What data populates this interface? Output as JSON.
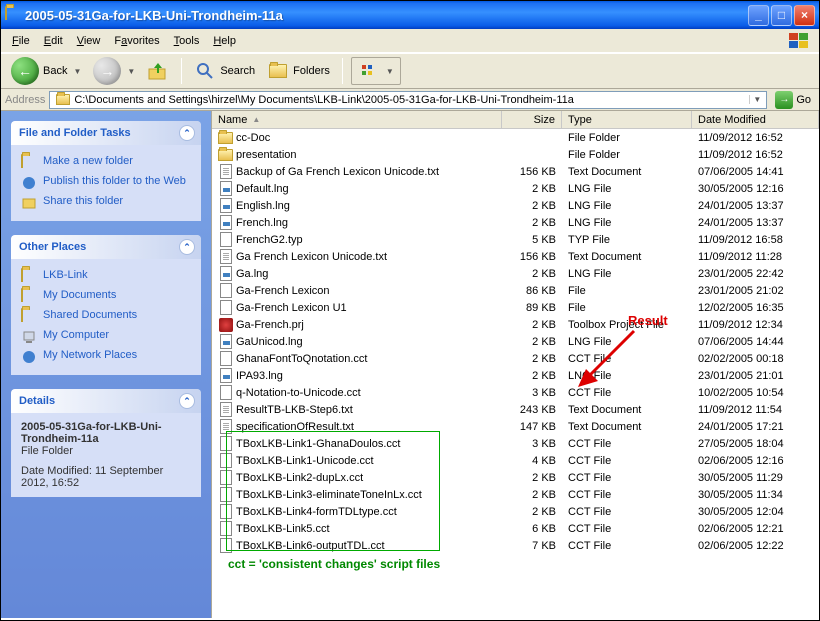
{
  "window": {
    "title": "2005-05-31Ga-for-LKB-Uni-Trondheim-11a"
  },
  "menu": [
    "File",
    "Edit",
    "View",
    "Favorites",
    "Tools",
    "Help"
  ],
  "toolbar": {
    "back": "Back",
    "search": "Search",
    "folders": "Folders"
  },
  "address": {
    "label": "Address",
    "path": "C:\\Documents and Settings\\hirzel\\My Documents\\LKB-Link\\2005-05-31Ga-for-LKB-Uni-Trondheim-11a",
    "go": "Go"
  },
  "sidepanel": {
    "tasks": {
      "title": "File and Folder Tasks",
      "items": [
        "Make a new folder",
        "Publish this folder to the Web",
        "Share this folder"
      ]
    },
    "places": {
      "title": "Other Places",
      "items": [
        "LKB-Link",
        "My Documents",
        "Shared Documents",
        "My Computer",
        "My Network Places"
      ]
    },
    "details": {
      "title": "Details",
      "name": "2005-05-31Ga-for-LKB-Uni-Trondheim-11a",
      "kind": "File Folder",
      "modified": "Date Modified: 11 September 2012, 16:52"
    }
  },
  "columns": {
    "name": "Name",
    "size": "Size",
    "type": "Type",
    "date": "Date Modified"
  },
  "files": [
    {
      "icon": "folder",
      "name": "cc-Doc",
      "size": "",
      "type": "File Folder",
      "date": "11/09/2012 16:52"
    },
    {
      "icon": "folder",
      "name": "presentation",
      "size": "",
      "type": "File Folder",
      "date": "11/09/2012 16:52"
    },
    {
      "icon": "txt",
      "name": "Backup of Ga French Lexicon Unicode.txt",
      "size": "156 KB",
      "type": "Text Document",
      "date": "07/06/2005 14:41"
    },
    {
      "icon": "lng",
      "name": "Default.lng",
      "size": "2 KB",
      "type": "LNG File",
      "date": "30/05/2005 12:16"
    },
    {
      "icon": "lng",
      "name": "English.lng",
      "size": "2 KB",
      "type": "LNG File",
      "date": "24/01/2005 13:37"
    },
    {
      "icon": "lng",
      "name": "French.lng",
      "size": "2 KB",
      "type": "LNG File",
      "date": "24/01/2005 13:37"
    },
    {
      "icon": "typ",
      "name": "FrenchG2.typ",
      "size": "5 KB",
      "type": "TYP File",
      "date": "11/09/2012 16:58"
    },
    {
      "icon": "txt",
      "name": "Ga French Lexicon Unicode.txt",
      "size": "156 KB",
      "type": "Text Document",
      "date": "11/09/2012 11:28"
    },
    {
      "icon": "lng",
      "name": "Ga.lng",
      "size": "2 KB",
      "type": "LNG File",
      "date": "23/01/2005 22:42"
    },
    {
      "icon": "file",
      "name": "Ga-French Lexicon",
      "size": "86 KB",
      "type": "File",
      "date": "23/01/2005 21:02"
    },
    {
      "icon": "file",
      "name": "Ga-French Lexicon U1",
      "size": "89 KB",
      "type": "File",
      "date": "12/02/2005 16:35"
    },
    {
      "icon": "prj",
      "name": "Ga-French.prj",
      "size": "2 KB",
      "type": "Toolbox Project File",
      "date": "11/09/2012 12:34"
    },
    {
      "icon": "lng",
      "name": "GaUnicod.lng",
      "size": "2 KB",
      "type": "LNG File",
      "date": "07/06/2005 14:44"
    },
    {
      "icon": "cct",
      "name": "GhanaFontToQnotation.cct",
      "size": "2 KB",
      "type": "CCT File",
      "date": "02/02/2005 00:18"
    },
    {
      "icon": "lng",
      "name": "IPA93.lng",
      "size": "2 KB",
      "type": "LNG File",
      "date": "23/01/2005 21:01"
    },
    {
      "icon": "cct",
      "name": "q-Notation-to-Unicode.cct",
      "size": "3 KB",
      "type": "CCT File",
      "date": "10/02/2005 10:54"
    },
    {
      "icon": "txt",
      "name": "ResultTB-LKB-Step6.txt",
      "size": "243 KB",
      "type": "Text Document",
      "date": "11/09/2012 11:54"
    },
    {
      "icon": "txt",
      "name": "specificationOfResult.txt",
      "size": "147 KB",
      "type": "Text Document",
      "date": "24/01/2005 17:21"
    },
    {
      "icon": "cct",
      "name": "TBoxLKB-Link1-GhanaDoulos.cct",
      "size": "3 KB",
      "type": "CCT File",
      "date": "27/05/2005 18:04"
    },
    {
      "icon": "cct",
      "name": "TBoxLKB-Link1-Unicode.cct",
      "size": "4 KB",
      "type": "CCT File",
      "date": "02/06/2005 12:16"
    },
    {
      "icon": "cct",
      "name": "TBoxLKB-Link2-dupLx.cct",
      "size": "2 KB",
      "type": "CCT File",
      "date": "30/05/2005 11:29"
    },
    {
      "icon": "cct",
      "name": "TBoxLKB-Link3-eliminateToneInLx.cct",
      "size": "2 KB",
      "type": "CCT File",
      "date": "30/05/2005 11:34"
    },
    {
      "icon": "cct",
      "name": "TBoxLKB-Link4-formTDLtype.cct",
      "size": "2 KB",
      "type": "CCT File",
      "date": "30/05/2005 12:04"
    },
    {
      "icon": "cct",
      "name": "TBoxLKB-Link5.cct",
      "size": "6 KB",
      "type": "CCT File",
      "date": "02/06/2005 12:21"
    },
    {
      "icon": "cct",
      "name": "TBoxLKB-Link6-outputTDL.cct",
      "size": "7 KB",
      "type": "CCT File",
      "date": "02/06/2005 12:22"
    }
  ],
  "annotations": {
    "result": "Result",
    "cct": "cct = 'consistent changes' script files"
  }
}
